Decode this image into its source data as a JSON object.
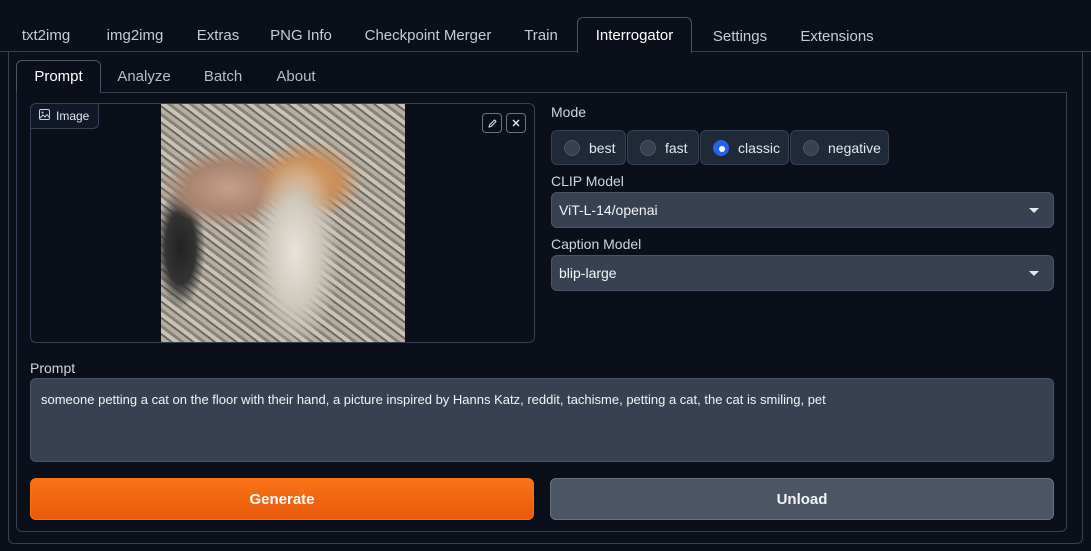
{
  "top_tabs": [
    {
      "label": "txt2img"
    },
    {
      "label": "img2img"
    },
    {
      "label": "Extras"
    },
    {
      "label": "PNG Info"
    },
    {
      "label": "Checkpoint Merger"
    },
    {
      "label": "Train"
    },
    {
      "label": "Interrogator"
    },
    {
      "label": "Settings"
    },
    {
      "label": "Extensions"
    }
  ],
  "active_top_tab": "Interrogator",
  "sub_tabs": [
    {
      "label": "Prompt"
    },
    {
      "label": "Analyze"
    },
    {
      "label": "Batch"
    },
    {
      "label": "About"
    }
  ],
  "active_sub_tab": "Prompt",
  "image_panel": {
    "label": "Image",
    "label_icon": "image-icon",
    "edit_icon": "pencil-icon",
    "clear_icon": "close-icon"
  },
  "mode": {
    "label": "Mode",
    "options": [
      {
        "label": "best"
      },
      {
        "label": "fast"
      },
      {
        "label": "classic"
      },
      {
        "label": "negative"
      }
    ],
    "selected": "classic"
  },
  "clip_model": {
    "label": "CLIP Model",
    "value": "ViT-L-14/openai"
  },
  "caption_model": {
    "label": "Caption Model",
    "value": "blip-large"
  },
  "prompt": {
    "label": "Prompt",
    "value": "someone petting a cat on the floor with their hand, a picture inspired by Hanns Katz, reddit, tachisme, petting a cat, the cat is smiling, pet"
  },
  "buttons": {
    "generate": "Generate",
    "unload": "Unload"
  },
  "colors": {
    "accent_orange": "#f97316",
    "radio_checked": "#2563eb",
    "background": "#0b0f19"
  }
}
